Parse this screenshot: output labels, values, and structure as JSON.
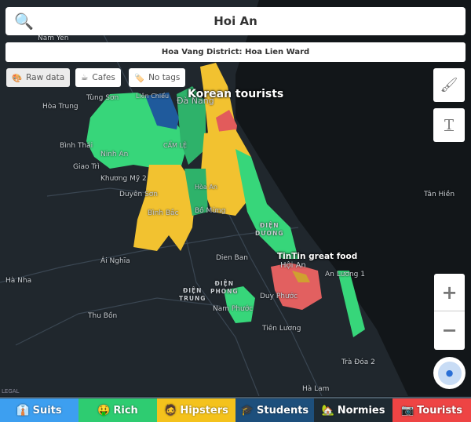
{
  "search": {
    "icon": "magnifier-icon",
    "query": "Hoi An"
  },
  "district": "Hoa Vang District: Hoa Lien Ward",
  "filters": [
    {
      "icon": "🎨",
      "label": "Raw data",
      "active": true
    },
    {
      "icon": "☕",
      "label": "Cafes",
      "active": false
    },
    {
      "icon": "🏷️",
      "label": "No tags",
      "active": false
    }
  ],
  "side_buttons": {
    "brush": "paintbrush-icon",
    "text": "text-icon"
  },
  "zoom": {
    "in": "+",
    "out": "−"
  },
  "legal": "LEGAL",
  "annotations": {
    "korean": "Korean tourists",
    "tintin": "TinTin great food"
  },
  "places": {
    "nam_yen": "Nam Yên",
    "tung_son": "Tùng Sơn",
    "lien_chieu": "Liên Chiểu",
    "hoa_trung": "Hòa Trung",
    "da_nang": "Đà Nẵng",
    "binh_thai": "Bình Thái",
    "ninh_an": "Ninh An",
    "cam_le": "CẨM LỆ",
    "giao_tri": "Giao Trì",
    "khuong_my": "Khương Mỹ 2",
    "duyen_son": "Duyên Sơn",
    "binh_bac": "Bình Bắc",
    "bo_mung": "Bồ Mừng",
    "hoa_an": "Hòa An",
    "dien_duong_1": "ĐIỆN",
    "dien_duong_2": "DƯƠNG",
    "tan_hien": "Tân Hiền",
    "ai_nghia": "Ái Nghĩa",
    "dien_ban": "Dien Ban",
    "hoi_an": "Hội An",
    "an_luong": "An Lương 1",
    "ha_nha": "Hà Nha",
    "dien_trung_1": "ĐIỆN",
    "dien_trung_2": "TRUNG",
    "dien_phong_1": "ĐIỆN",
    "dien_phong_2": "PHONG",
    "duy_phuoc": "Duy Phước",
    "nam_phuoc": "Nam Phước",
    "thu_bon": "Thu Bồn",
    "tien_luong": "Tiên Lương",
    "tra_doa": "Trà Đóa 2",
    "ha_lam": "Hà Lam"
  },
  "tabs": [
    {
      "icon": "👔",
      "label": "Suits",
      "color": "#3d9ff0"
    },
    {
      "icon": "🤑",
      "label": "Rich",
      "color": "#2ecc71"
    },
    {
      "icon": "🧔",
      "label": "Hipsters",
      "color": "#f4c21c"
    },
    {
      "icon": "🎓",
      "label": "Students",
      "color": "#1d4f7c"
    },
    {
      "icon": "🏡",
      "label": "Normies",
      "color": "#1e2a32"
    },
    {
      "icon": "📷",
      "label": "Tourists",
      "color": "#ee4444"
    }
  ]
}
